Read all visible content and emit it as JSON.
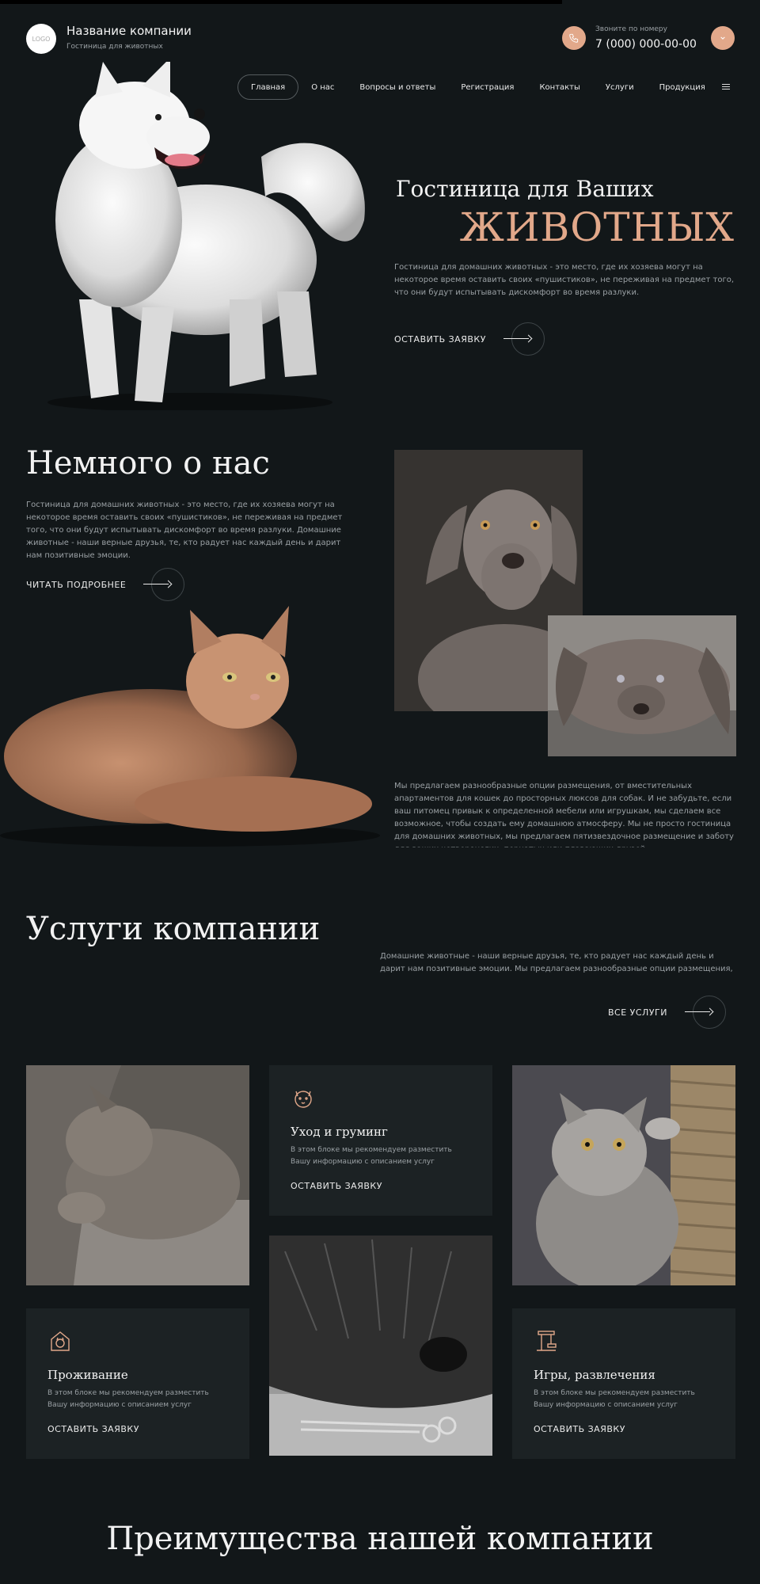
{
  "header": {
    "logo_text": "LOGO",
    "company_name": "Название компании",
    "company_subtitle": "Гостиница для животных",
    "phone_label": "Звоните по номеру",
    "phone_number": "7 (000) 000-00-00"
  },
  "nav": {
    "items": [
      "Главная",
      "О нас",
      "Вопросы и ответы",
      "Регистрация",
      "Контакты",
      "Услуги",
      "Продукция"
    ],
    "active_index": 0
  },
  "hero": {
    "title": "Гостиница для Ваших",
    "accent": "ЖИВОТНЫХ",
    "text": "Гостиница для домашних животных - это место, где их хозяева могут на некоторое время оставить своих «пушистиков», не переживая на предмет того, что они будут испытывать дискомфорт во время разлуки.",
    "cta": "ОСТАВИТЬ ЗАЯВКУ"
  },
  "about": {
    "title": "Немного о нас",
    "text": "Гостиница для домашних животных - это место, где их хозяева могут на некоторое время оставить своих «пушистиков», не переживая на предмет того, что они будут испытывать дискомфорт во время разлуки. Домашние животные - наши верные друзья, те, кто радует нас каждый день и дарит нам позитивные эмоции.",
    "cta": "ЧИТАТЬ ПОДРОБНЕЕ",
    "more_text": "Мы предлагаем разнообразные опции размещения, от вместительных апартаментов для кошек до просторных люксов для собак. И не забудьте, если ваш питомец привык к определенной мебели или игрушкам, мы сделаем все возможное, чтобы создать ему домашнюю атмосферу. Мы не просто гостиница для домашних животных, мы предлагаем пятизвездочное размещение и заботу для ваших четвероногих, пернатых или плавающих друзей."
  },
  "services": {
    "title": "Услуги компании",
    "text": "Домашние животные - наши верные друзья, те, кто радует нас каждый день и дарит нам позитивные эмоции. Мы предлагаем разнообразные опции размещения,",
    "all_cta": "ВСЕ УСЛУГИ",
    "cards": [
      {
        "name": "Уход и груминг",
        "desc": "В этом блоке мы рекомендуем разместить Вашу информацию с описанием услуг",
        "cta": "ОСТАВИТЬ ЗАЯВКУ",
        "icon": "dog-face-icon"
      },
      {
        "name": "Проживание",
        "desc": "В этом блоке мы рекомендуем разместить Вашу информацию с описанием услуг",
        "cta": "ОСТАВИТЬ ЗАЯВКУ",
        "icon": "cat-house-icon"
      },
      {
        "name": "Игры, развлечения",
        "desc": "В этом блоке мы рекомендуем разместить Вашу информацию с описанием услуг",
        "cta": "ОСТАВИТЬ ЗАЯВКУ",
        "icon": "cat-tree-icon"
      }
    ]
  },
  "advantages": {
    "title": "Преимущества нашей компании"
  },
  "colors": {
    "background": "#121719",
    "accent": "#e2a88a",
    "card": "#1c2224",
    "muted_text": "#9aa0a4"
  }
}
